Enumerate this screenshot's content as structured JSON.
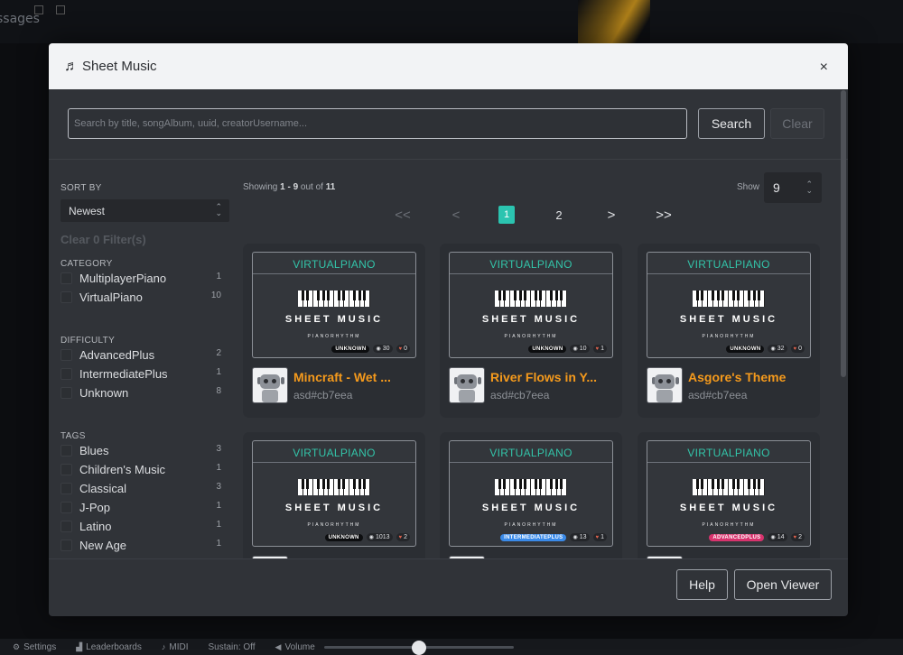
{
  "background": {
    "partial_text": "ssages",
    "bottom_bar": [
      {
        "icon": "gear-icon",
        "label": "Settings"
      },
      {
        "icon": "leaderboard-icon",
        "label": "Leaderboards"
      },
      {
        "icon": "midi-icon",
        "label": "MIDI"
      },
      {
        "icon": "",
        "label": "Sustain: Off"
      },
      {
        "icon": "volume-icon",
        "label": "Volume"
      }
    ],
    "volume_level": 0.5
  },
  "modal": {
    "title": "Sheet Music",
    "close_symbol": "×",
    "search": {
      "placeholder": "Search by title, songAlbum, uuid, creatorUsername...",
      "value": "",
      "search_label": "Search",
      "clear_label": "Clear"
    },
    "sidebar": {
      "sort_label": "SORT BY",
      "sort_value": "Newest",
      "clear_filters": "Clear 0 Filter(s)",
      "category_label": "CATEGORY",
      "categories": [
        {
          "label": "MultiplayerPiano",
          "count": "1"
        },
        {
          "label": "VirtualPiano",
          "count": "10"
        }
      ],
      "difficulty_label": "DIFFICULTY",
      "difficulties": [
        {
          "label": "AdvancedPlus",
          "count": "2"
        },
        {
          "label": "IntermediatePlus",
          "count": "1"
        },
        {
          "label": "Unknown",
          "count": "8"
        }
      ],
      "tags_label": "TAGS",
      "tags": [
        {
          "label": "Blues",
          "count": "3"
        },
        {
          "label": "Children's Music",
          "count": "1"
        },
        {
          "label": "Classical",
          "count": "3"
        },
        {
          "label": "J-Pop",
          "count": "1"
        },
        {
          "label": "Latino",
          "count": "1"
        },
        {
          "label": "New Age",
          "count": "1"
        }
      ]
    },
    "results": {
      "showing_prefix": "Showing ",
      "showing_range": "1 - 9",
      "showing_mid": " out of ",
      "showing_total": "11",
      "show_label": "Show",
      "show_value": "9"
    },
    "pagination": {
      "first": "<<",
      "prev": "<",
      "pages": [
        "1",
        "2"
      ],
      "current": "1",
      "next": ">",
      "last": ">>"
    },
    "cards": [
      {
        "category": "VIRTUALPIANO",
        "difficulty": "UNKNOWN",
        "difficulty_style": "unknown",
        "views": "30",
        "likes": "0",
        "title": "Mincraft - Wet ...",
        "author": "asd#cb7eea"
      },
      {
        "category": "VIRTUALPIANO",
        "difficulty": "UNKNOWN",
        "difficulty_style": "unknown",
        "views": "10",
        "likes": "1",
        "title": "River Flows in Y...",
        "author": "asd#cb7eea"
      },
      {
        "category": "VIRTUALPIANO",
        "difficulty": "UNKNOWN",
        "difficulty_style": "unknown",
        "views": "32",
        "likes": "0",
        "title": "Asgore's Theme",
        "author": "asd#cb7eea"
      },
      {
        "category": "VIRTUALPIANO",
        "difficulty": "UNKNOWN",
        "difficulty_style": "unknown",
        "views": "1013",
        "likes": "2",
        "title": "",
        "author": ""
      },
      {
        "category": "VIRTUALPIANO",
        "difficulty": "INTERMEDIATEPLUS",
        "difficulty_style": "intermediate",
        "views": "13",
        "likes": "1",
        "title": "",
        "author": ""
      },
      {
        "category": "VIRTUALPIANO",
        "difficulty": "ADVANCEDPLUS",
        "difficulty_style": "advanced",
        "views": "14",
        "likes": "2",
        "title": "",
        "author": ""
      }
    ],
    "thumbnail": {
      "heading": "SHEET MUSIC",
      "brand": "PIANORHYTHM"
    },
    "footer": {
      "help_label": "Help",
      "viewer_label": "Open Viewer"
    }
  },
  "colors": {
    "accent": "#2bc4b0",
    "title": "#f59a1c",
    "category": "#33c4a9"
  }
}
